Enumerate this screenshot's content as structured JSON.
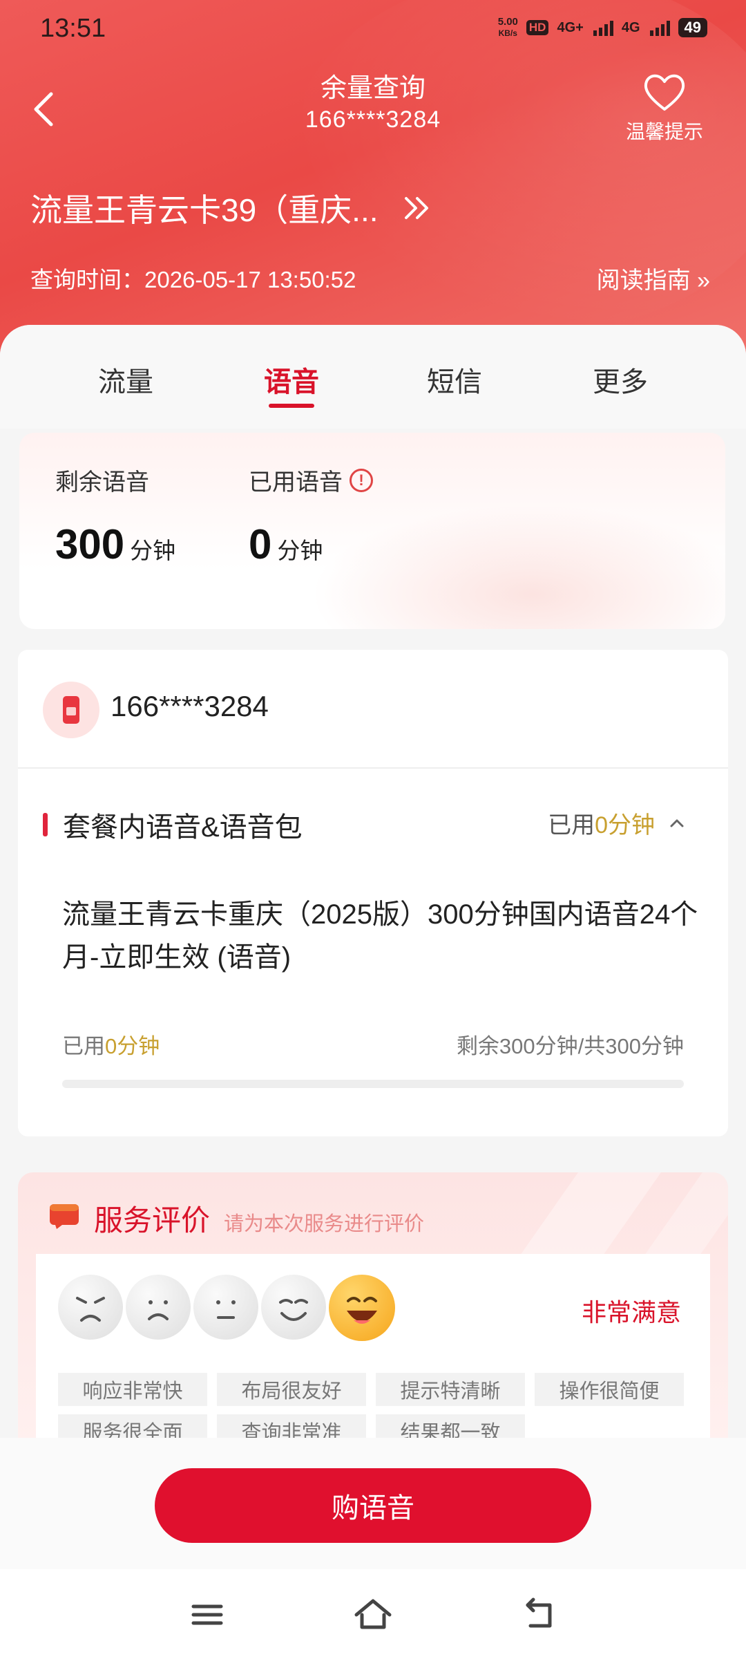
{
  "status_bar": {
    "time": "13:51",
    "net_speed_value": "5.00",
    "net_speed_unit": "KB/s",
    "hd": "HD",
    "sim1": "4G+",
    "sim2": "4G",
    "battery": "49"
  },
  "header": {
    "title": "余量查询",
    "subtitle": "166****3284",
    "tip_label": "温馨提示",
    "plan_name": "流量王青云卡39（重庆...",
    "query_time": "查询时间：2026-05-17 13:50:52",
    "guide_link": "阅读指南 »"
  },
  "tabs": [
    {
      "label": "流量",
      "active": false
    },
    {
      "label": "语音",
      "active": true
    },
    {
      "label": "短信",
      "active": false
    },
    {
      "label": "更多",
      "active": false
    }
  ],
  "summary": {
    "remaining_label": "剩余语音",
    "remaining_value": "300",
    "remaining_unit": "分钟",
    "used_label": "已用语音",
    "used_value": "0",
    "used_unit": "分钟"
  },
  "detail": {
    "phone": "166****3284",
    "section_title": "套餐内语音&语音包",
    "section_used_prefix": "已用",
    "section_used_value": "0分钟",
    "package_name": "流量王青云卡重庆（2025版）300分钟国内语音24个月-立即生效 (语音)",
    "used_prefix": "已用",
    "used_value": "0分钟",
    "remaining_text": "剩余300分钟/共300分钟",
    "progress_fraction": 0
  },
  "rating": {
    "title": "服务评价",
    "subtitle": "请为本次服务进行评价",
    "selected_label": "非常满意",
    "chips": [
      "响应非常快",
      "布局很友好",
      "提示特清晰",
      "操作很简便",
      "服务很全面",
      "查询非常准",
      "结果都一致"
    ]
  },
  "actions": {
    "buy_label": "购语音"
  },
  "colors": {
    "brand_red": "#d9132a",
    "header_red": "#ea4946",
    "gold": "#c8a030"
  }
}
